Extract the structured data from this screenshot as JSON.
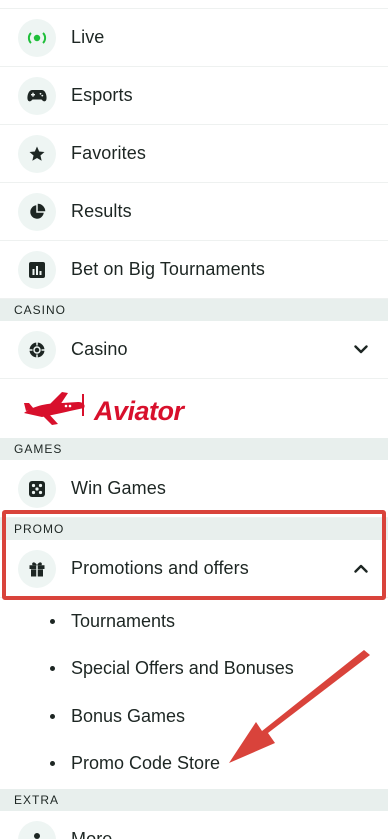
{
  "menu": {
    "live": "Live",
    "esports": "Esports",
    "favorites": "Favorites",
    "results": "Results",
    "big_tournaments": "Bet on Big Tournaments"
  },
  "casino": {
    "header": "CASINO",
    "item": "Casino",
    "aviator_brand": "Aviator"
  },
  "games": {
    "header": "GAMES",
    "item": "Win Games"
  },
  "promo": {
    "header": "PROMO",
    "item": "Promotions and offers",
    "subitems": [
      "Tournaments",
      "Special Offers and Bonuses",
      "Bonus Games",
      "Promo Code Store"
    ]
  },
  "extra": {
    "header": "EXTRA",
    "item": "More"
  },
  "colors": {
    "accent_green": "#1fbf3a",
    "icon_dark": "#1d2623",
    "section_bg": "#e8efed",
    "highlight_red": "#d9433b",
    "aviator_red": "#d8102c"
  }
}
